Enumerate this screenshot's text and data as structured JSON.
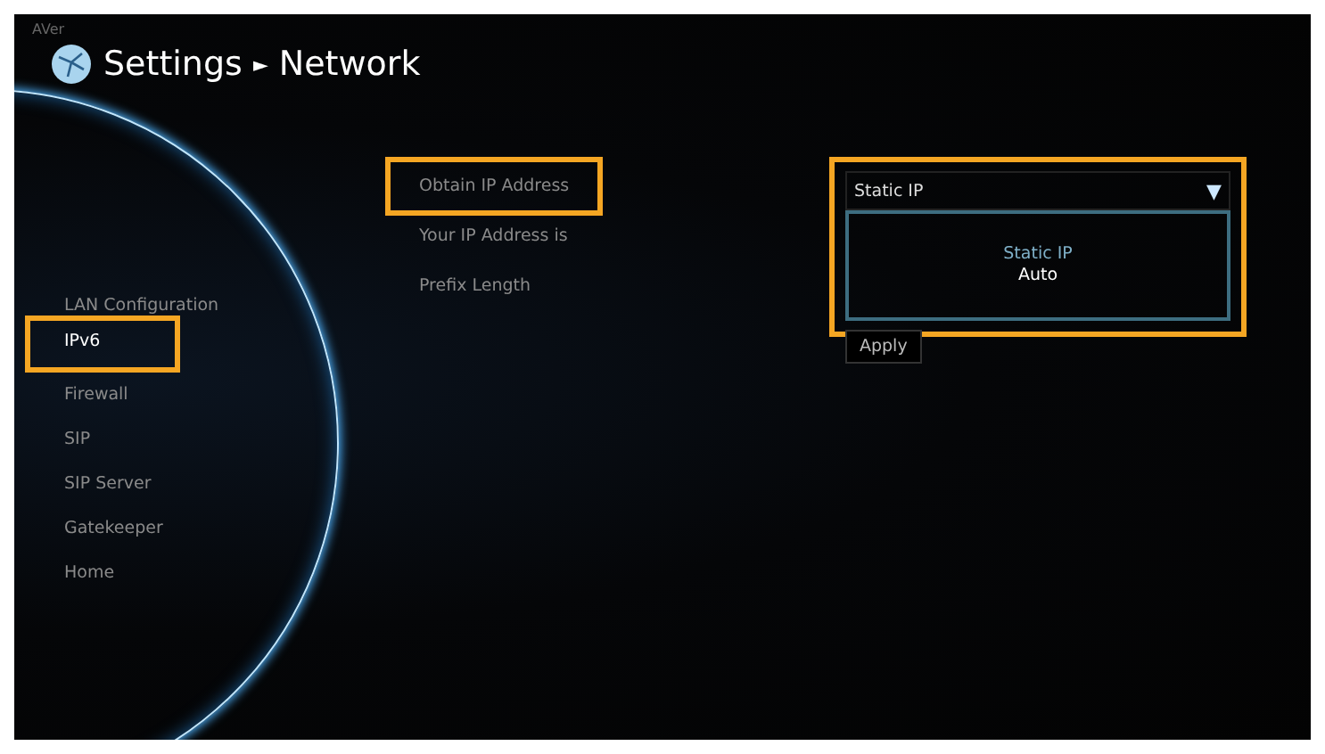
{
  "header": {
    "logo_text": "AVer",
    "title": "Settings",
    "separator": "►",
    "subtitle": "Network"
  },
  "sidebar": {
    "items": [
      {
        "label": "LAN Configuration",
        "selected": false,
        "highlighted": false
      },
      {
        "label": "IPv6",
        "selected": true,
        "highlighted": true
      },
      {
        "label": "Firewall",
        "selected": false,
        "highlighted": false
      },
      {
        "label": "SIP",
        "selected": false,
        "highlighted": false
      },
      {
        "label": "SIP Server",
        "selected": false,
        "highlighted": false
      },
      {
        "label": "Gatekeeper",
        "selected": false,
        "highlighted": false
      },
      {
        "label": "Home",
        "selected": false,
        "highlighted": false
      }
    ]
  },
  "fields": [
    {
      "label": "Obtain IP Address",
      "highlighted": true
    },
    {
      "label": "Your IP Address is",
      "highlighted": false
    },
    {
      "label": "Prefix Length",
      "highlighted": false
    }
  ],
  "dropdown": {
    "value": "Static IP",
    "arrow": "▼",
    "expanded": true,
    "highlighted": true,
    "options": [
      {
        "label": "Static IP",
        "selected": true
      },
      {
        "label": "Auto",
        "selected": false
      }
    ]
  },
  "apply_button": {
    "label": "Apply"
  }
}
